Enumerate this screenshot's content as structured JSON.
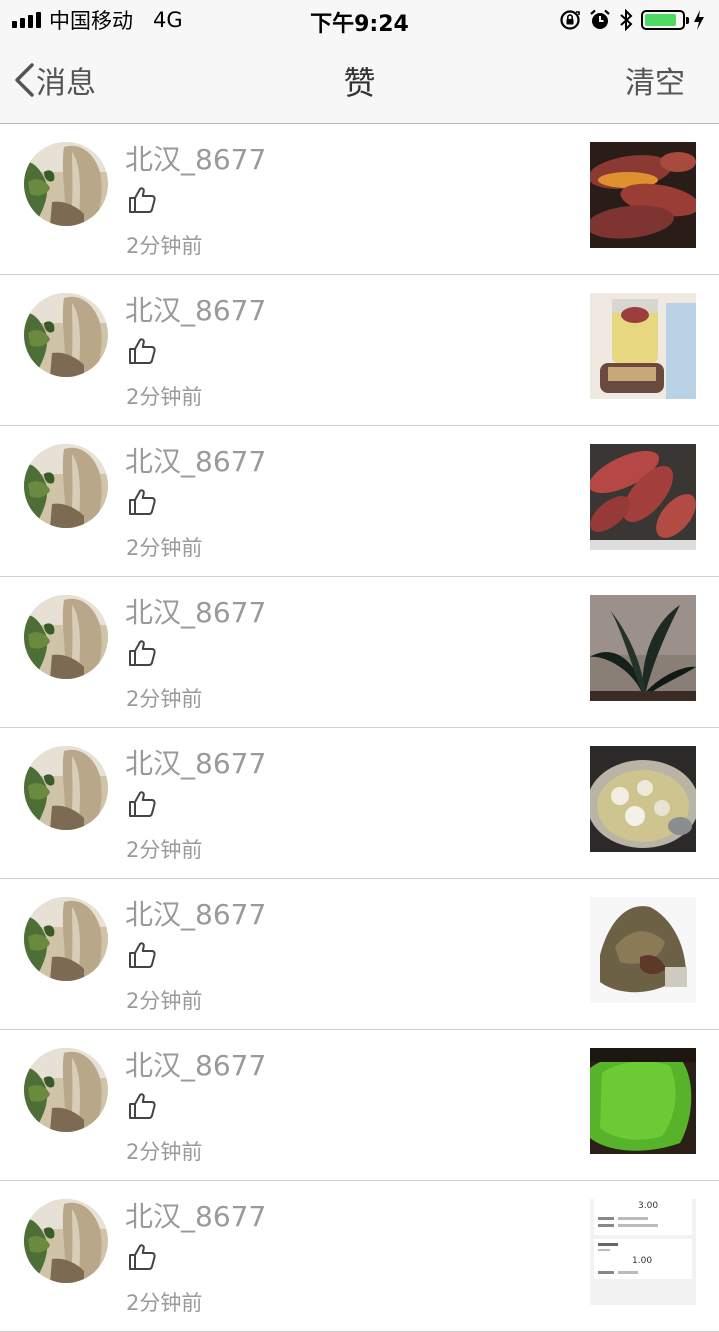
{
  "status_bar": {
    "carrier": "中国移动",
    "network": "4G",
    "time": "下午9:24",
    "icons": [
      "signal-icon",
      "orientation-lock-icon",
      "alarm-icon",
      "bluetooth-icon",
      "battery-icon",
      "charging-icon"
    ],
    "battery_level": 0.85,
    "battery_color": "#4cd964"
  },
  "nav": {
    "back_label": "消息",
    "title": "赞",
    "right_action": "清空"
  },
  "items": [
    {
      "name": "北汉_8677",
      "time": "2分钟前",
      "thumb": "sweet-potatoes-cooked"
    },
    {
      "name": "北汉_8677",
      "time": "2分钟前",
      "thumb": "tea-pot"
    },
    {
      "name": "北汉_8677",
      "time": "2分钟前",
      "thumb": "sweet-potatoes"
    },
    {
      "name": "北汉_8677",
      "time": "2分钟前",
      "thumb": "green-plant"
    },
    {
      "name": "北汉_8677",
      "time": "2分钟前",
      "thumb": "hot-pot"
    },
    {
      "name": "北汉_8677",
      "time": "2分钟前",
      "thumb": "rice-dumpling"
    },
    {
      "name": "北汉_8677",
      "time": "2分钟前",
      "thumb": "green-fruit"
    },
    {
      "name": "北汉_8677",
      "time": "2分钟前",
      "thumb": "receipt-screenshot"
    }
  ],
  "colors": {
    "text_gray": "#9a9a9a",
    "nav_bg": "#f7f7f7",
    "divider": "#cfcfcf"
  }
}
